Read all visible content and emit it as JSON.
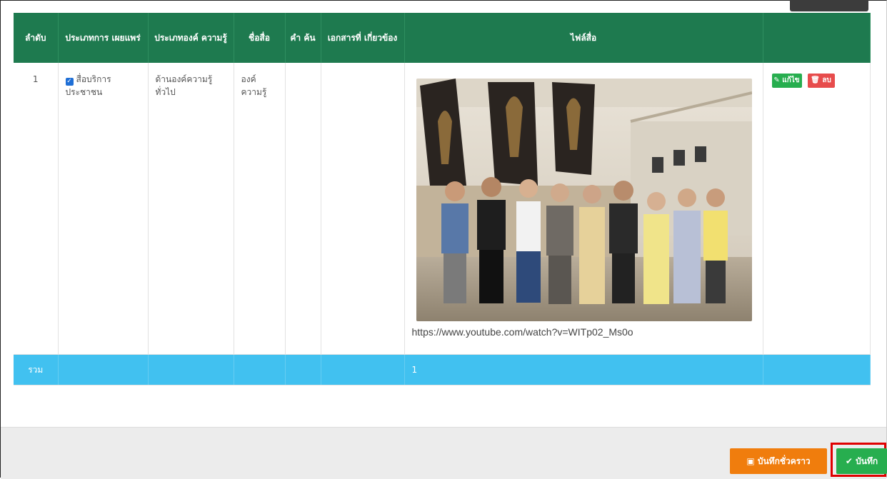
{
  "table": {
    "headers": [
      "ลำดับ",
      "ประเภทการ เผยแพร่",
      "ประเภทองค์ ความรู้",
      "ชื่อสื่อ",
      "คำ ค้น",
      "เอกสารที่ เกี่ยวข้อง",
      "ไฟล์สื่อ",
      ""
    ],
    "row": {
      "index": "1",
      "publish_type": "สื่อบริการประชาชน",
      "knowledge_type": "ด้านองค์ความรู้ทั่วไป",
      "media_name": "องค์ ความรู้",
      "keywords": "",
      "related_docs": "",
      "media_url": "https://www.youtube.com/watch?v=WITp02_Ms0o",
      "edit_label": "แก้ไข",
      "delete_label": "ลบ"
    },
    "total": {
      "label": "รวม",
      "value": "1"
    }
  },
  "footer": {
    "draft_label": "บันทึกชั่วคราว",
    "save_label": "บันทึก"
  },
  "colors": {
    "header_green": "#1e7a4f",
    "total_blue": "#41c1f0",
    "edit_green": "#27ae4f",
    "delete_red": "#e74c4c",
    "draft_orange": "#f07d0d",
    "highlight_red": "#e00000"
  },
  "icons": {
    "checkbox": "checked-checkbox-icon",
    "edit": "pencil-icon",
    "delete": "trash-icon",
    "draft": "floppy-disk-icon",
    "save": "checkmark-icon"
  }
}
